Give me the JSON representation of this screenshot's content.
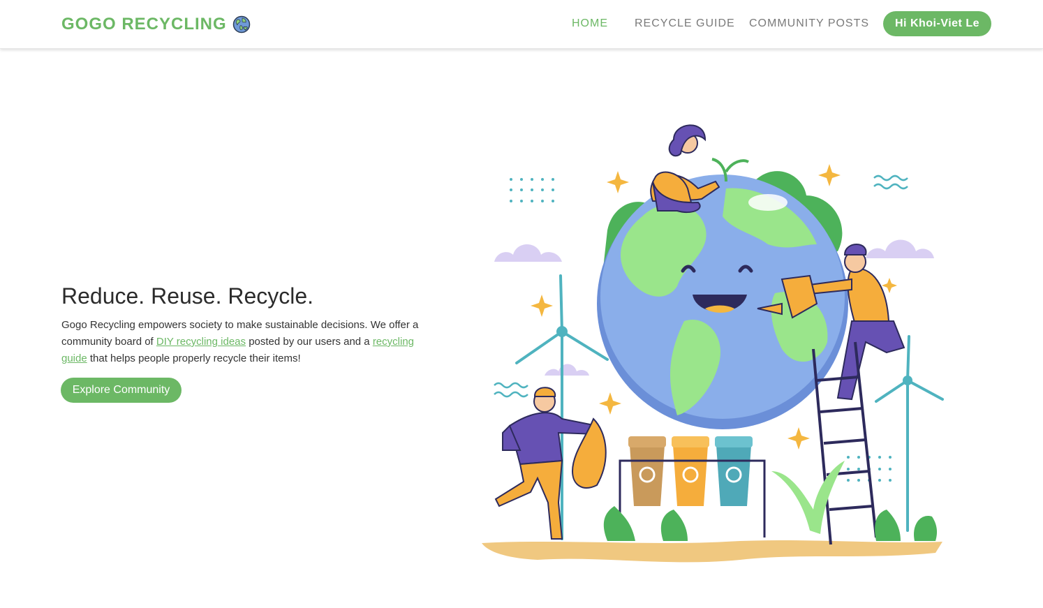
{
  "brand": {
    "name": "GOGO RECYCLING",
    "icon": "earth-globe-icon"
  },
  "nav": {
    "home": "HOME",
    "recycle_guide": "RECYCLE GUIDE",
    "community_posts": "COMMUNITY POSTS",
    "user_greeting": "Hi Khoi-Viet Le",
    "active": "HOME"
  },
  "hero": {
    "title": "Reduce. Reuse. Recycle.",
    "text_part1": "Gogo Recycling empowers society to make sustainable decisions. We offer a community board of ",
    "link1": "DIY recycling ideas",
    "text_part2": " posted by our users and a ",
    "link2": "recycling guide",
    "text_part3": " that helps people properly recycle their items!",
    "cta_label": "Explore Community"
  },
  "illustration": {
    "icon": "earth-recycling-illustration"
  },
  "colors": {
    "brand_green": "#6cb865",
    "nav_gray": "#7a7a7a"
  }
}
